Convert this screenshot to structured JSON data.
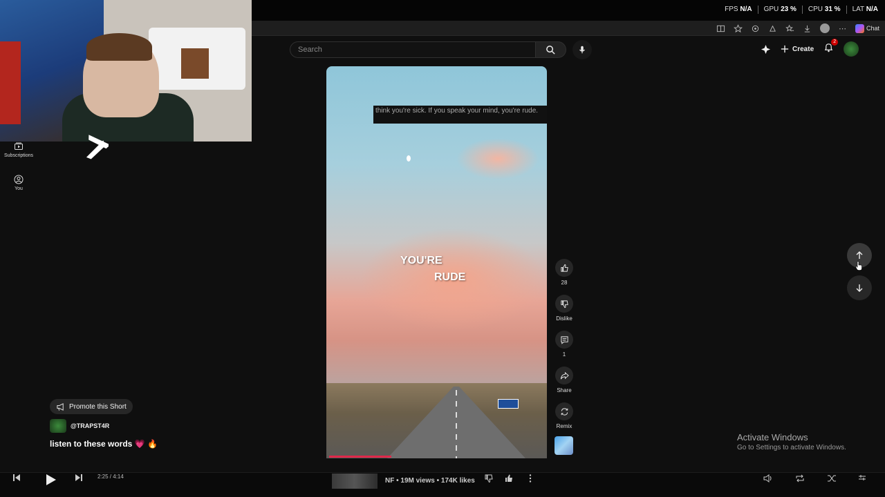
{
  "overlay": {
    "stats": [
      {
        "label": "FPS",
        "value": "N/A"
      },
      {
        "label": "GPU",
        "value": "23 %"
      },
      {
        "label": "CPU",
        "value": "31 %"
      },
      {
        "label": "LAT",
        "value": "N/A"
      }
    ]
  },
  "browser": {
    "chat_label": "Chat"
  },
  "sidebar": {
    "items": [
      {
        "label": "Subscriptions",
        "icon": "subscriptions-icon"
      },
      {
        "label": "You",
        "icon": "you-icon"
      }
    ]
  },
  "header": {
    "search_placeholder": "Search",
    "create_label": "Create",
    "notification_count": "2"
  },
  "video": {
    "caption": "think you're sick. If you speak your mind, you're rude.",
    "lyric_line1": "YOU'RE",
    "lyric_line2": "RUDE",
    "progress_fraction": 0.29
  },
  "actions": {
    "like_count": "28",
    "dislike_label": "Dislike",
    "comment_count": "1",
    "share_label": "Share",
    "remix_label": "Remix"
  },
  "meta": {
    "promote_label": "Promote this Short",
    "channel": "@TRAPST4R",
    "description": "listen to these words 💗 🔥"
  },
  "watermark": {
    "title": "Activate Windows",
    "subtitle": "Go to Settings to activate Windows."
  },
  "musicbar": {
    "time": "2:25 / 4:14",
    "info": "NF • 19M views • 174K likes"
  }
}
